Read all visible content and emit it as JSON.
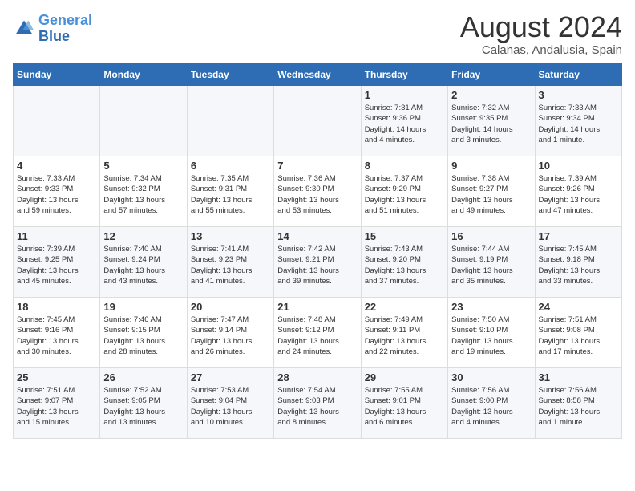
{
  "logo": {
    "line1": "General",
    "line2": "Blue"
  },
  "title": "August 2024",
  "subtitle": "Calanas, Andalusia, Spain",
  "days_of_week": [
    "Sunday",
    "Monday",
    "Tuesday",
    "Wednesday",
    "Thursday",
    "Friday",
    "Saturday"
  ],
  "weeks": [
    [
      {
        "day": "",
        "info": ""
      },
      {
        "day": "",
        "info": ""
      },
      {
        "day": "",
        "info": ""
      },
      {
        "day": "",
        "info": ""
      },
      {
        "day": "1",
        "info": "Sunrise: 7:31 AM\nSunset: 9:36 PM\nDaylight: 14 hours\nand 4 minutes."
      },
      {
        "day": "2",
        "info": "Sunrise: 7:32 AM\nSunset: 9:35 PM\nDaylight: 14 hours\nand 3 minutes."
      },
      {
        "day": "3",
        "info": "Sunrise: 7:33 AM\nSunset: 9:34 PM\nDaylight: 14 hours\nand 1 minute."
      }
    ],
    [
      {
        "day": "4",
        "info": "Sunrise: 7:33 AM\nSunset: 9:33 PM\nDaylight: 13 hours\nand 59 minutes."
      },
      {
        "day": "5",
        "info": "Sunrise: 7:34 AM\nSunset: 9:32 PM\nDaylight: 13 hours\nand 57 minutes."
      },
      {
        "day": "6",
        "info": "Sunrise: 7:35 AM\nSunset: 9:31 PM\nDaylight: 13 hours\nand 55 minutes."
      },
      {
        "day": "7",
        "info": "Sunrise: 7:36 AM\nSunset: 9:30 PM\nDaylight: 13 hours\nand 53 minutes."
      },
      {
        "day": "8",
        "info": "Sunrise: 7:37 AM\nSunset: 9:29 PM\nDaylight: 13 hours\nand 51 minutes."
      },
      {
        "day": "9",
        "info": "Sunrise: 7:38 AM\nSunset: 9:27 PM\nDaylight: 13 hours\nand 49 minutes."
      },
      {
        "day": "10",
        "info": "Sunrise: 7:39 AM\nSunset: 9:26 PM\nDaylight: 13 hours\nand 47 minutes."
      }
    ],
    [
      {
        "day": "11",
        "info": "Sunrise: 7:39 AM\nSunset: 9:25 PM\nDaylight: 13 hours\nand 45 minutes."
      },
      {
        "day": "12",
        "info": "Sunrise: 7:40 AM\nSunset: 9:24 PM\nDaylight: 13 hours\nand 43 minutes."
      },
      {
        "day": "13",
        "info": "Sunrise: 7:41 AM\nSunset: 9:23 PM\nDaylight: 13 hours\nand 41 minutes."
      },
      {
        "day": "14",
        "info": "Sunrise: 7:42 AM\nSunset: 9:21 PM\nDaylight: 13 hours\nand 39 minutes."
      },
      {
        "day": "15",
        "info": "Sunrise: 7:43 AM\nSunset: 9:20 PM\nDaylight: 13 hours\nand 37 minutes."
      },
      {
        "day": "16",
        "info": "Sunrise: 7:44 AM\nSunset: 9:19 PM\nDaylight: 13 hours\nand 35 minutes."
      },
      {
        "day": "17",
        "info": "Sunrise: 7:45 AM\nSunset: 9:18 PM\nDaylight: 13 hours\nand 33 minutes."
      }
    ],
    [
      {
        "day": "18",
        "info": "Sunrise: 7:45 AM\nSunset: 9:16 PM\nDaylight: 13 hours\nand 30 minutes."
      },
      {
        "day": "19",
        "info": "Sunrise: 7:46 AM\nSunset: 9:15 PM\nDaylight: 13 hours\nand 28 minutes."
      },
      {
        "day": "20",
        "info": "Sunrise: 7:47 AM\nSunset: 9:14 PM\nDaylight: 13 hours\nand 26 minutes."
      },
      {
        "day": "21",
        "info": "Sunrise: 7:48 AM\nSunset: 9:12 PM\nDaylight: 13 hours\nand 24 minutes."
      },
      {
        "day": "22",
        "info": "Sunrise: 7:49 AM\nSunset: 9:11 PM\nDaylight: 13 hours\nand 22 minutes."
      },
      {
        "day": "23",
        "info": "Sunrise: 7:50 AM\nSunset: 9:10 PM\nDaylight: 13 hours\nand 19 minutes."
      },
      {
        "day": "24",
        "info": "Sunrise: 7:51 AM\nSunset: 9:08 PM\nDaylight: 13 hours\nand 17 minutes."
      }
    ],
    [
      {
        "day": "25",
        "info": "Sunrise: 7:51 AM\nSunset: 9:07 PM\nDaylight: 13 hours\nand 15 minutes."
      },
      {
        "day": "26",
        "info": "Sunrise: 7:52 AM\nSunset: 9:05 PM\nDaylight: 13 hours\nand 13 minutes."
      },
      {
        "day": "27",
        "info": "Sunrise: 7:53 AM\nSunset: 9:04 PM\nDaylight: 13 hours\nand 10 minutes."
      },
      {
        "day": "28",
        "info": "Sunrise: 7:54 AM\nSunset: 9:03 PM\nDaylight: 13 hours\nand 8 minutes."
      },
      {
        "day": "29",
        "info": "Sunrise: 7:55 AM\nSunset: 9:01 PM\nDaylight: 13 hours\nand 6 minutes."
      },
      {
        "day": "30",
        "info": "Sunrise: 7:56 AM\nSunset: 9:00 PM\nDaylight: 13 hours\nand 4 minutes."
      },
      {
        "day": "31",
        "info": "Sunrise: 7:56 AM\nSunset: 8:58 PM\nDaylight: 13 hours\nand 1 minute."
      }
    ]
  ]
}
